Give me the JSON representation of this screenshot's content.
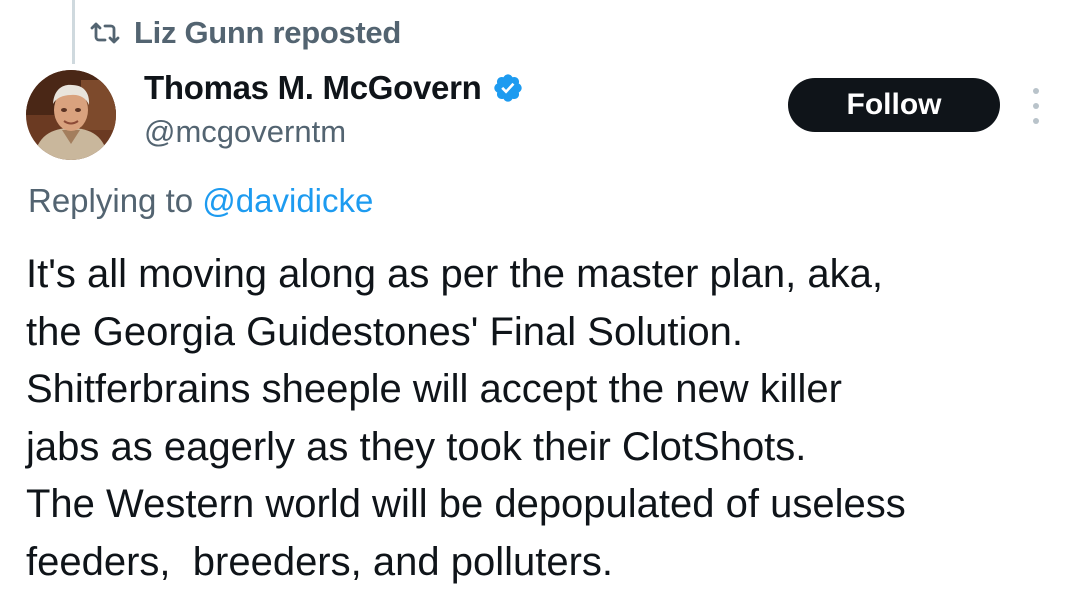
{
  "repost": {
    "icon": "repost-icon",
    "text": "Liz Gunn reposted"
  },
  "author": {
    "avatar": "avatar-photo",
    "display_name": "Thomas M. McGovern",
    "verified_icon": "verified-badge-icon",
    "verified_color": "#1d9bf0",
    "handle": "@mcgoverntm"
  },
  "actions": {
    "follow_label": "Follow",
    "more_icon": "more-vertical-icon"
  },
  "reply": {
    "prefix": "Replying to",
    "mention": "@davidicke"
  },
  "tweet": {
    "lines": [
      "It's all moving along as per the master plan, aka,",
      "the Georgia Guidestones' Final Solution.",
      "Shitferbrains sheeple will accept the new killer",
      "jabs as eagerly as they took their ClotShots.",
      "The Western world will be depopulated of useless",
      "feeders,  breeders, and polluters."
    ]
  },
  "colors": {
    "text_primary": "#0f1419",
    "text_secondary": "#536471",
    "link": "#1d9bf0",
    "follow_bg": "#0f1419",
    "follow_text": "#ffffff"
  }
}
